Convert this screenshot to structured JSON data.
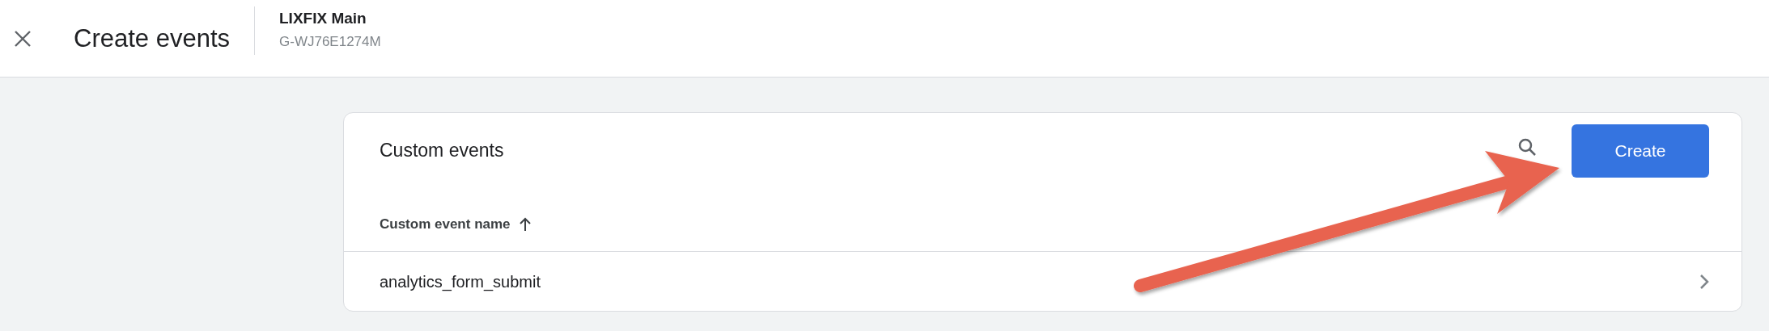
{
  "header": {
    "title": "Create events",
    "property_name": "LIXFIX Main",
    "property_id": "G-WJ76E1274M"
  },
  "card": {
    "title": "Custom events",
    "create_button": "Create",
    "columns": [
      {
        "label": "Custom event name",
        "sort_ascending": true
      }
    ],
    "rows": [
      {
        "name": "analytics_form_submit"
      }
    ]
  }
}
